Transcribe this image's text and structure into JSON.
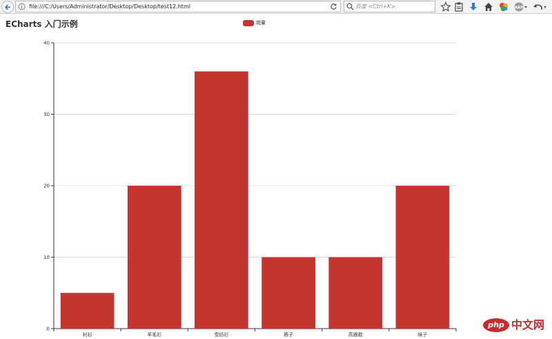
{
  "browser": {
    "url": "file:///C:/Users/Administrator/Desktop/Desktop/test12.html",
    "search_placeholder": "百度 <Ctrl+K>",
    "icons": [
      "back-arrow-icon",
      "info-icon",
      "reload-icon",
      "search-icon",
      "bookmark-star-icon",
      "clipboard-icon",
      "download-icon",
      "home-icon",
      "colorful-addon-icon",
      "abp-icon",
      "undo-icon"
    ]
  },
  "page": {
    "title": "ECharts 入门示例"
  },
  "chart_data": {
    "type": "bar",
    "categories": [
      "衬衫",
      "羊毛衫",
      "雪纺衫",
      "裤子",
      "高跟鞋",
      "袜子"
    ],
    "series": [
      {
        "name": "销量",
        "values": [
          5,
          20,
          36,
          10,
          10,
          20
        ],
        "color": "#c23531"
      }
    ],
    "ylim": [
      0,
      40
    ],
    "yticks": [
      0,
      10,
      20,
      30,
      40
    ],
    "grid": true,
    "legend_position": "top-center"
  },
  "watermark": {
    "logo_text": "php",
    "text": "中文网"
  }
}
